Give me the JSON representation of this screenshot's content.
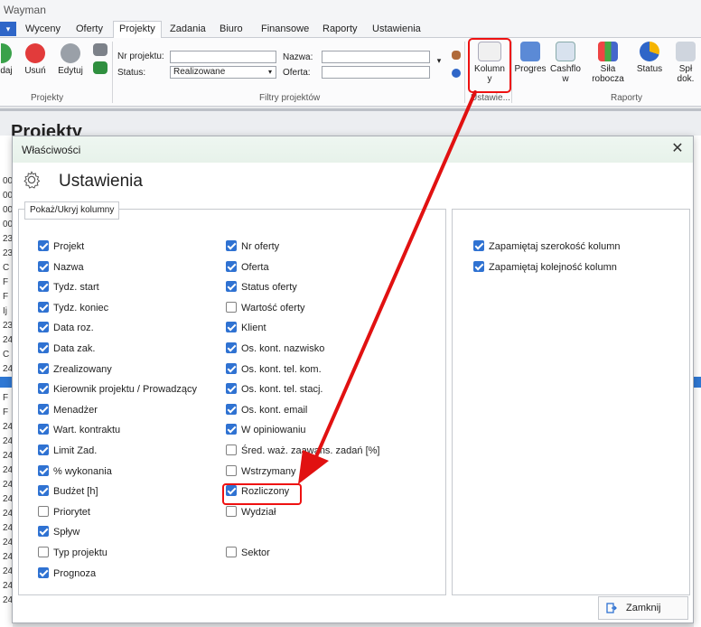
{
  "app": {
    "title": "Wayman",
    "tabs": [
      "Wyceny",
      "Oferty",
      "Projekty",
      "Zadania",
      "Biuro",
      "Finansowe",
      "Raporty",
      "Ustawienia"
    ]
  },
  "ribbon": {
    "projekty_buttons": [
      "daj",
      "Usuń",
      "Edytuj"
    ],
    "projekty_group": "Projekty",
    "filter": {
      "nr_label": "Nr projektu:",
      "status_label": "Status:",
      "status_value": "Realizowane",
      "nazwa_label": "Nazwa:",
      "oferta_label": "Oferta:",
      "group": "Filtry projektów"
    },
    "kolumny_label_1": "Kolumn",
    "kolumny_label_2": "y",
    "ustawienia_group": "Ustawie...",
    "progres": "Progres",
    "cashflow_1": "Cashflo",
    "cashflow_2": "w",
    "sila_1": "Siła",
    "sila_2": "robocza",
    "status": "Status",
    "spl_1": "Spł",
    "spl_2": "dok.",
    "raporty_group": "Raporty"
  },
  "page_heading": "Projekty",
  "left_strip": [
    "00",
    "00",
    "00",
    "00",
    "23",
    "23",
    "C",
    "F",
    "F",
    "Ij",
    "23",
    "24",
    "C",
    "24",
    "C",
    "F",
    "F",
    "24",
    "24",
    "24",
    "24",
    "24",
    "24",
    "24",
    "24",
    "24",
    "24",
    "24",
    "24",
    "24"
  ],
  "dialog": {
    "title": "Właściwości",
    "heading": "Ustawienia",
    "group_title": "Pokaż/Ukryj kolumny",
    "col1": [
      {
        "label": "Projekt",
        "checked": true
      },
      {
        "label": "Nazwa",
        "checked": true
      },
      {
        "label": "Tydz. start",
        "checked": true
      },
      {
        "label": "Tydz. koniec",
        "checked": true
      },
      {
        "label": "Data roz.",
        "checked": true
      },
      {
        "label": "Data zak.",
        "checked": true
      },
      {
        "label": "Zrealizowany",
        "checked": true
      },
      {
        "label": "Kierownik projektu / Prowadzący",
        "checked": true
      },
      {
        "label": "Menadżer",
        "checked": true
      },
      {
        "label": "Wart. kontraktu",
        "checked": true
      },
      {
        "label": "Limit Zad.",
        "checked": true
      },
      {
        "label": "% wykonania",
        "checked": true
      },
      {
        "label": "Budżet [h]",
        "checked": true
      },
      {
        "label": "Priorytet",
        "checked": false
      },
      {
        "label": "Spływ",
        "checked": true
      },
      {
        "label": "Typ projektu",
        "checked": false
      },
      {
        "label": "Prognoza",
        "checked": true
      }
    ],
    "col2": [
      {
        "label": "Nr oferty",
        "checked": true
      },
      {
        "label": "Oferta",
        "checked": true
      },
      {
        "label": "Status oferty",
        "checked": true
      },
      {
        "label": "Wartość oferty",
        "checked": false
      },
      {
        "label": "Klient",
        "checked": true
      },
      {
        "label": "Os. kont. nazwisko",
        "checked": true
      },
      {
        "label": "Os. kont. tel. kom.",
        "checked": true
      },
      {
        "label": "Os. kont. tel. stacj.",
        "checked": true
      },
      {
        "label": "Os. kont. email",
        "checked": true
      },
      {
        "label": "W opiniowaniu",
        "checked": true
      },
      {
        "label": "Śred. waż. zaawans. zadań [%]",
        "checked": false
      },
      {
        "label": "Wstrzymany",
        "checked": false
      },
      {
        "label": "Rozliczony",
        "checked": true
      },
      {
        "label": "Wydział",
        "checked": false
      },
      {
        "label": "",
        "checked": null
      },
      {
        "label": "Sektor",
        "checked": false
      }
    ],
    "col3": [
      {
        "label": "Zapamiętaj szerokość kolumn",
        "checked": true
      },
      {
        "label": "Zapamiętaj kolejność kolumn",
        "checked": true
      }
    ],
    "close_label": "Zamknij"
  },
  "colors": {
    "accent": "#2f72d2",
    "highlight": "#e11111"
  }
}
